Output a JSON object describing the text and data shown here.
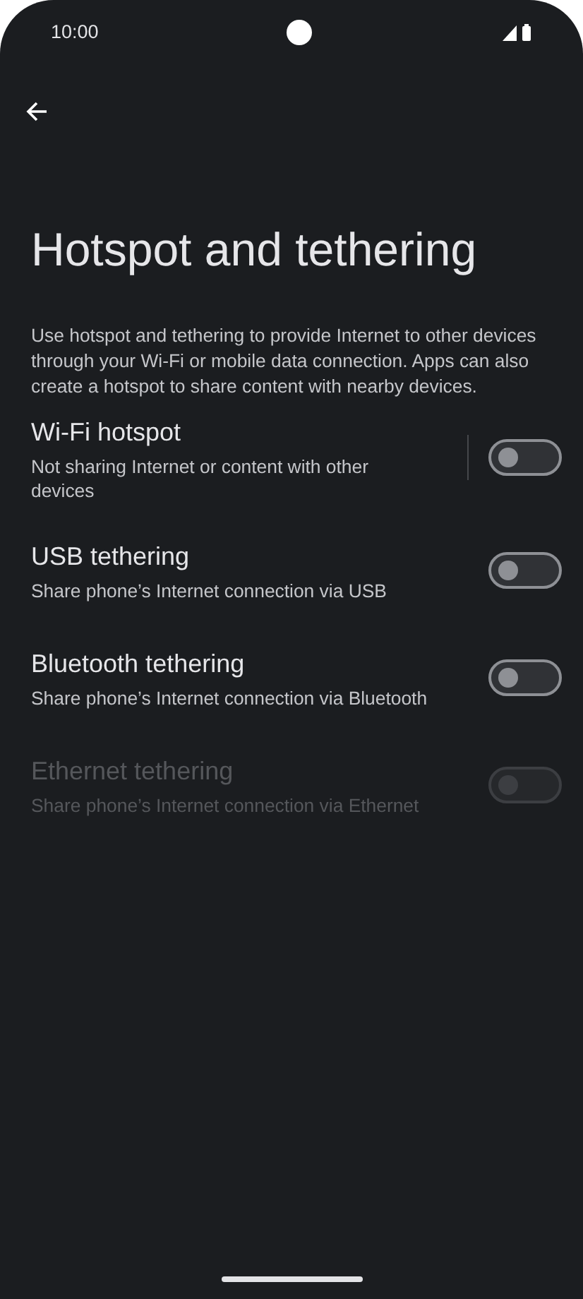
{
  "status_bar": {
    "time": "10:00"
  },
  "title": "Hotspot and tethering",
  "description": "Use hotspot and tethering to provide Internet to other devices through your Wi-Fi or mobile data connection. Apps can also create a hotspot to share content with nearby devices.",
  "settings": [
    {
      "kind": "split",
      "title": "Wi-Fi hotspot",
      "summary": "Not sharing Internet or content with other devices",
      "on": false,
      "disabled": false
    },
    {
      "kind": "plain",
      "title": "USB tethering",
      "summary": "Share phone’s Internet connection via USB",
      "on": false,
      "disabled": false
    },
    {
      "kind": "plain",
      "title": "Bluetooth tethering",
      "summary": "Share phone’s Internet connection via Bluetooth",
      "on": false,
      "disabled": false
    },
    {
      "kind": "plain",
      "title": "Ethernet tethering",
      "summary": "Share phone’s Internet connection via Ethernet",
      "on": false,
      "disabled": true
    }
  ]
}
